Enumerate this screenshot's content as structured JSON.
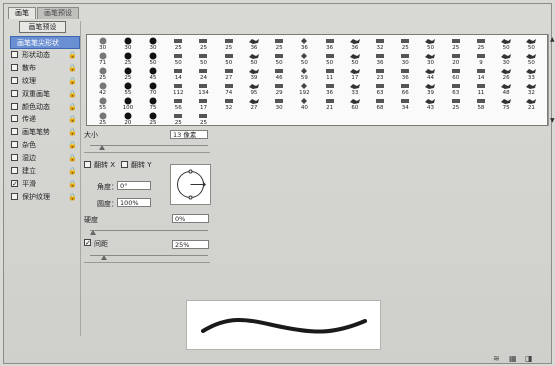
{
  "tabs": [
    "画笔",
    "画笔预设"
  ],
  "sidebar": {
    "preset_button": "画笔预设",
    "items": [
      {
        "label": "画笔笔尖形状",
        "selected": true,
        "checked": false,
        "locked": false
      },
      {
        "label": "形状动态",
        "selected": false,
        "checked": false,
        "locked": true
      },
      {
        "label": "散布",
        "selected": false,
        "checked": false,
        "locked": true
      },
      {
        "label": "纹理",
        "selected": false,
        "checked": false,
        "locked": true
      },
      {
        "label": "双重画笔",
        "selected": false,
        "checked": false,
        "locked": true
      },
      {
        "label": "颜色动态",
        "selected": false,
        "checked": false,
        "locked": true
      },
      {
        "label": "传递",
        "selected": false,
        "checked": false,
        "locked": true
      },
      {
        "label": "画笔笔势",
        "selected": false,
        "checked": false,
        "locked": true
      },
      {
        "label": "杂色",
        "selected": false,
        "checked": false,
        "locked": true
      },
      {
        "label": "湿边",
        "selected": false,
        "checked": false,
        "locked": true
      },
      {
        "label": "建立",
        "selected": false,
        "checked": false,
        "locked": true
      },
      {
        "label": "平滑",
        "selected": false,
        "checked": true,
        "locked": true
      },
      {
        "label": "保护纹理",
        "selected": false,
        "checked": false,
        "locked": true
      }
    ]
  },
  "brush_tips": {
    "sizes": [
      "30",
      "30",
      "30",
      "25",
      "25",
      "25",
      "36",
      "25",
      "36",
      "36",
      "36",
      "32",
      "25",
      "50",
      "25",
      "25",
      "50",
      "50",
      "71",
      "25",
      "50",
      "50",
      "50",
      "50",
      "50",
      "50",
      "50",
      "50",
      "50",
      "36",
      "30",
      "30",
      "20",
      "9",
      "30",
      "50",
      "25",
      "25",
      "45",
      "14",
      "24",
      "27",
      "39",
      "46",
      "59",
      "11",
      "17",
      "23",
      "36",
      "44",
      "60",
      "14",
      "26",
      "33",
      "42",
      "55",
      "70",
      "112",
      "134",
      "74",
      "95",
      "29",
      "192",
      "36",
      "33",
      "63",
      "66",
      "39",
      "63",
      "11",
      "48",
      "32",
      "55",
      "100",
      "75",
      "56",
      "17",
      "32",
      "27",
      "30",
      "40",
      "21",
      "60",
      "68",
      "34",
      "43",
      "25",
      "58",
      "75",
      "21",
      "25",
      "20",
      "25",
      "25",
      "25"
    ],
    "icons": [
      "soft-round-brush-icon",
      "hard-round-brush-icon",
      "hard-round-brush-icon",
      "chalk-brush-icon",
      "chalk-brush-icon",
      "chalk-brush-icon",
      "spray-brush-icon",
      "chalk-brush-icon",
      "spatter-brush-icon",
      "chalk-brush-icon",
      "spray-brush-icon",
      "chalk-brush-icon",
      "chalk-brush-icon",
      "spray-brush-icon",
      "chalk-brush-icon",
      "chalk-brush-icon",
      "spray-brush-icon",
      "spray-brush-icon"
    ]
  },
  "controls": {
    "size_label": "大小",
    "size_value": "13 像素",
    "size_slider_fraction": 0.08,
    "flip_x_label": "翻转 X",
    "flip_x_checked": false,
    "flip_y_label": "翻转 Y",
    "flip_y_checked": false,
    "angle_label": "角度：",
    "angle_value": "0°",
    "roundness_label": "圆度：",
    "roundness_value": "100%",
    "hardness_label": "硬度",
    "hardness_value": "0%",
    "hardness_slider_fraction": 0.0,
    "spacing_label": "间距",
    "spacing_checked": true,
    "spacing_value": "25%",
    "spacing_slider_fraction": 0.1
  },
  "colors": {
    "selection": "#6b8fd3",
    "stroke": "#1a1a1a"
  },
  "bottom_icons": [
    "toggle-brush-icon",
    "grid-icon",
    "new-brush-icon"
  ]
}
